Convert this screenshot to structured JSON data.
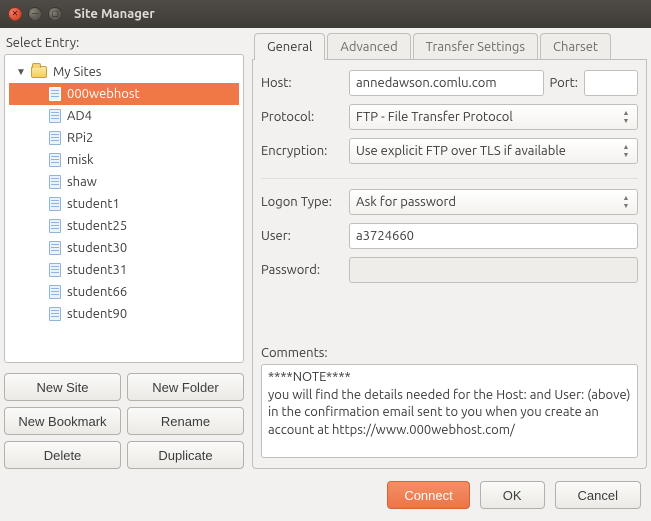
{
  "window": {
    "title": "Site Manager"
  },
  "left": {
    "select_entry": "Select Entry:",
    "root": "My Sites",
    "sites": [
      "000webhost",
      "AD4",
      "RPi2",
      "misk",
      "shaw",
      "student1",
      "student25",
      "student30",
      "student31",
      "student66",
      "student90"
    ],
    "selected_index": 0,
    "buttons": {
      "new_site": "New Site",
      "new_folder": "New Folder",
      "new_bookmark": "New Bookmark",
      "rename": "Rename",
      "delete": "Delete",
      "duplicate": "Duplicate"
    }
  },
  "tabs": {
    "general": "General",
    "advanced": "Advanced",
    "transfer": "Transfer Settings",
    "charset": "Charset"
  },
  "general": {
    "labels": {
      "host": "Host:",
      "port": "Port:",
      "protocol": "Protocol:",
      "encryption": "Encryption:",
      "logon_type": "Logon Type:",
      "user": "User:",
      "password": "Password:",
      "comments": "Comments:"
    },
    "host": "annedawson.comlu.com",
    "port": "",
    "protocol": "FTP - File Transfer Protocol",
    "encryption": "Use explicit FTP over TLS if available",
    "logon_type": "Ask for password",
    "user": "a3724660",
    "password": "",
    "comments": "****NOTE****\nyou will find the details needed for the Host: and User: (above) in the confirmation email sent to you when you create an account at https://www.000webhost.com/"
  },
  "footer": {
    "connect": "Connect",
    "ok": "OK",
    "cancel": "Cancel"
  }
}
